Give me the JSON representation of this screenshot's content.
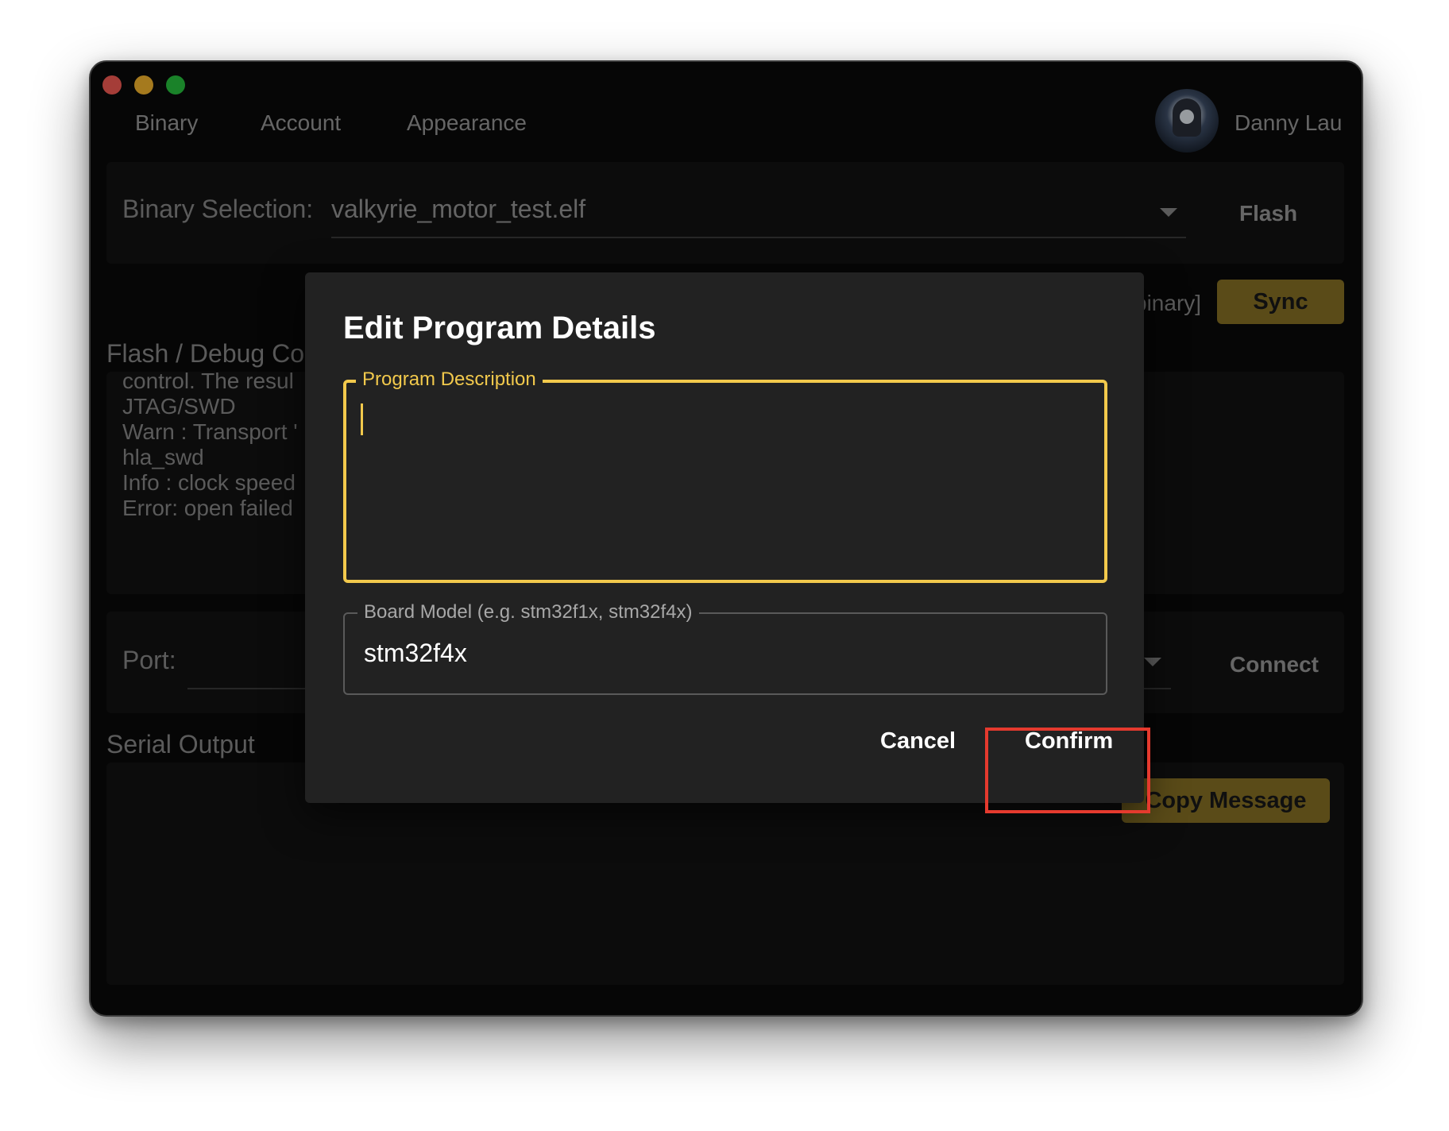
{
  "nav": {
    "tabs": [
      {
        "label": "Binary"
      },
      {
        "label": "Account"
      },
      {
        "label": "Appearance"
      }
    ],
    "user": {
      "name": "Danny Lau"
    }
  },
  "binary_panel": {
    "label": "Binary Selection:",
    "selected": "valkyrie_motor_test.elf",
    "flash_label": "Flash"
  },
  "sync_row": {
    "partial_text": "pinary]",
    "sync_label": "Sync"
  },
  "debug": {
    "heading_partial": "Flash / Debug Co",
    "log_lines": [
      "control. The resul",
      "JTAG/SWD",
      "Warn : Transport '",
      "hla_swd",
      "Info : clock speed",
      "Error: open failed"
    ]
  },
  "port_panel": {
    "label": "Port:",
    "connect_label": "Connect"
  },
  "serial": {
    "heading": "Serial Output",
    "copy_label": "Copy Message"
  },
  "dialog": {
    "title": "Edit Program Details",
    "description_legend": "Program Description",
    "description_value": "",
    "board_legend": "Board Model (e.g. stm32f1x, stm32f4x)",
    "board_value": "stm32f4x",
    "cancel_label": "Cancel",
    "confirm_label": "Confirm"
  },
  "colors": {
    "accent_gold": "#f2c94c",
    "button_gold": "#8a7426",
    "highlight_red": "#e53a2e",
    "window_bg": "#0a0a0a",
    "dialog_bg": "#222222"
  }
}
